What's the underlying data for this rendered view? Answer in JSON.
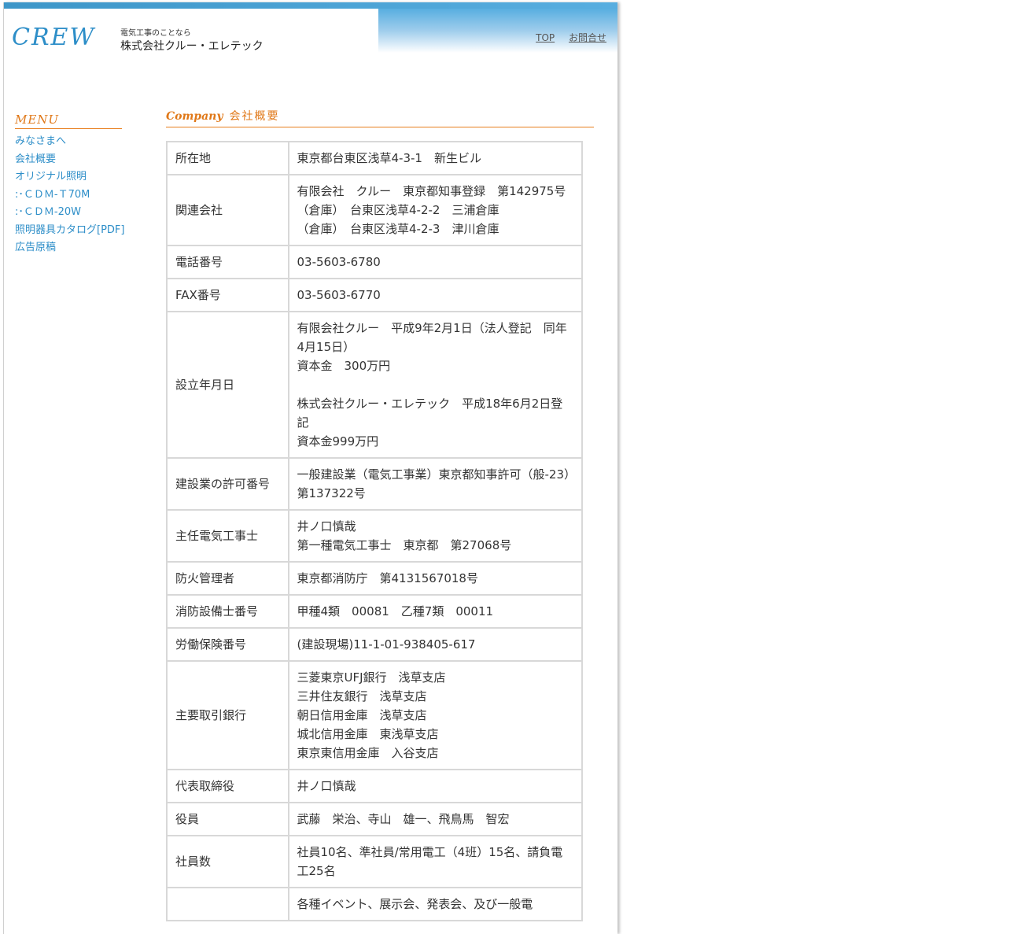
{
  "header": {
    "logo_text": "CREW",
    "tagline": "電気工事のことなら",
    "company_name": "株式会社クルー・エレテック",
    "nav": [
      "TOP",
      "お問合せ"
    ]
  },
  "sidebar": {
    "menu_title": "MENU",
    "items": [
      "みなさまへ",
      "会社概要",
      "オリジナル照明",
      ":･ＣＤＭ-Ｔ70M",
      ":･ＣＤＭ-20W",
      "照明器具カタログ[PDF]",
      "広告原稿"
    ]
  },
  "main": {
    "section_title_en": "Company",
    "section_title_ja": "会社概要",
    "rows": [
      {
        "label": "所在地",
        "lines": [
          "東京都台東区浅草4-3-1　新生ビル"
        ]
      },
      {
        "label": "関連会社",
        "lines": [
          "有限会社　クルー　東京都知事登録　第142975号",
          "（倉庫）　台東区浅草4-2-2　三浦倉庫",
          "（倉庫）　台東区浅草4-2-3　津川倉庫"
        ]
      },
      {
        "label": "電話番号",
        "lines": [
          "03-5603-6780"
        ]
      },
      {
        "label": "FAX番号",
        "lines": [
          "03-5603-6770"
        ]
      },
      {
        "label": "設立年月日",
        "lines": [
          "有限会社クルー　平成9年2月1日（法人登記　同年4月15日）",
          "資本金　300万円",
          "",
          "株式会社クルー・エレテック　平成18年6月2日登記",
          "資本金999万円"
        ]
      },
      {
        "label": "建設業の許可番号",
        "lines": [
          "一般建設業（電気工事業）東京都知事許可（般-23）第137322号"
        ]
      },
      {
        "label": "主任電気工事士",
        "lines": [
          "井ノ口慎哉",
          "第一種電気工事士　東京都　第27068号"
        ]
      },
      {
        "label": "防火管理者",
        "lines": [
          "東京都消防庁　第4131567018号"
        ]
      },
      {
        "label": "消防設備士番号",
        "lines": [
          "甲種4類　00081　乙種7類　00011"
        ]
      },
      {
        "label": "労働保険番号",
        "lines": [
          "(建設現場)11-1-01-938405-617"
        ]
      },
      {
        "label": "主要取引銀行",
        "lines": [
          "三菱東京UFJ銀行　浅草支店",
          "三井住友銀行　浅草支店",
          "朝日信用金庫　浅草支店",
          "城北信用金庫　東浅草支店",
          "東京東信用金庫　入谷支店"
        ]
      },
      {
        "label": "代表取締役",
        "lines": [
          "井ノ口慎哉"
        ]
      },
      {
        "label": "役員",
        "lines": [
          "武藤　栄治、寺山　雄一、飛鳥馬　智宏"
        ]
      },
      {
        "label": "社員数",
        "lines": [
          "社員10名、準社員/常用電工（4班）15名、請負電工25名"
        ]
      },
      {
        "label": "",
        "lines": [
          "各種イベント、展示会、発表会、及び一般電"
        ]
      }
    ]
  }
}
